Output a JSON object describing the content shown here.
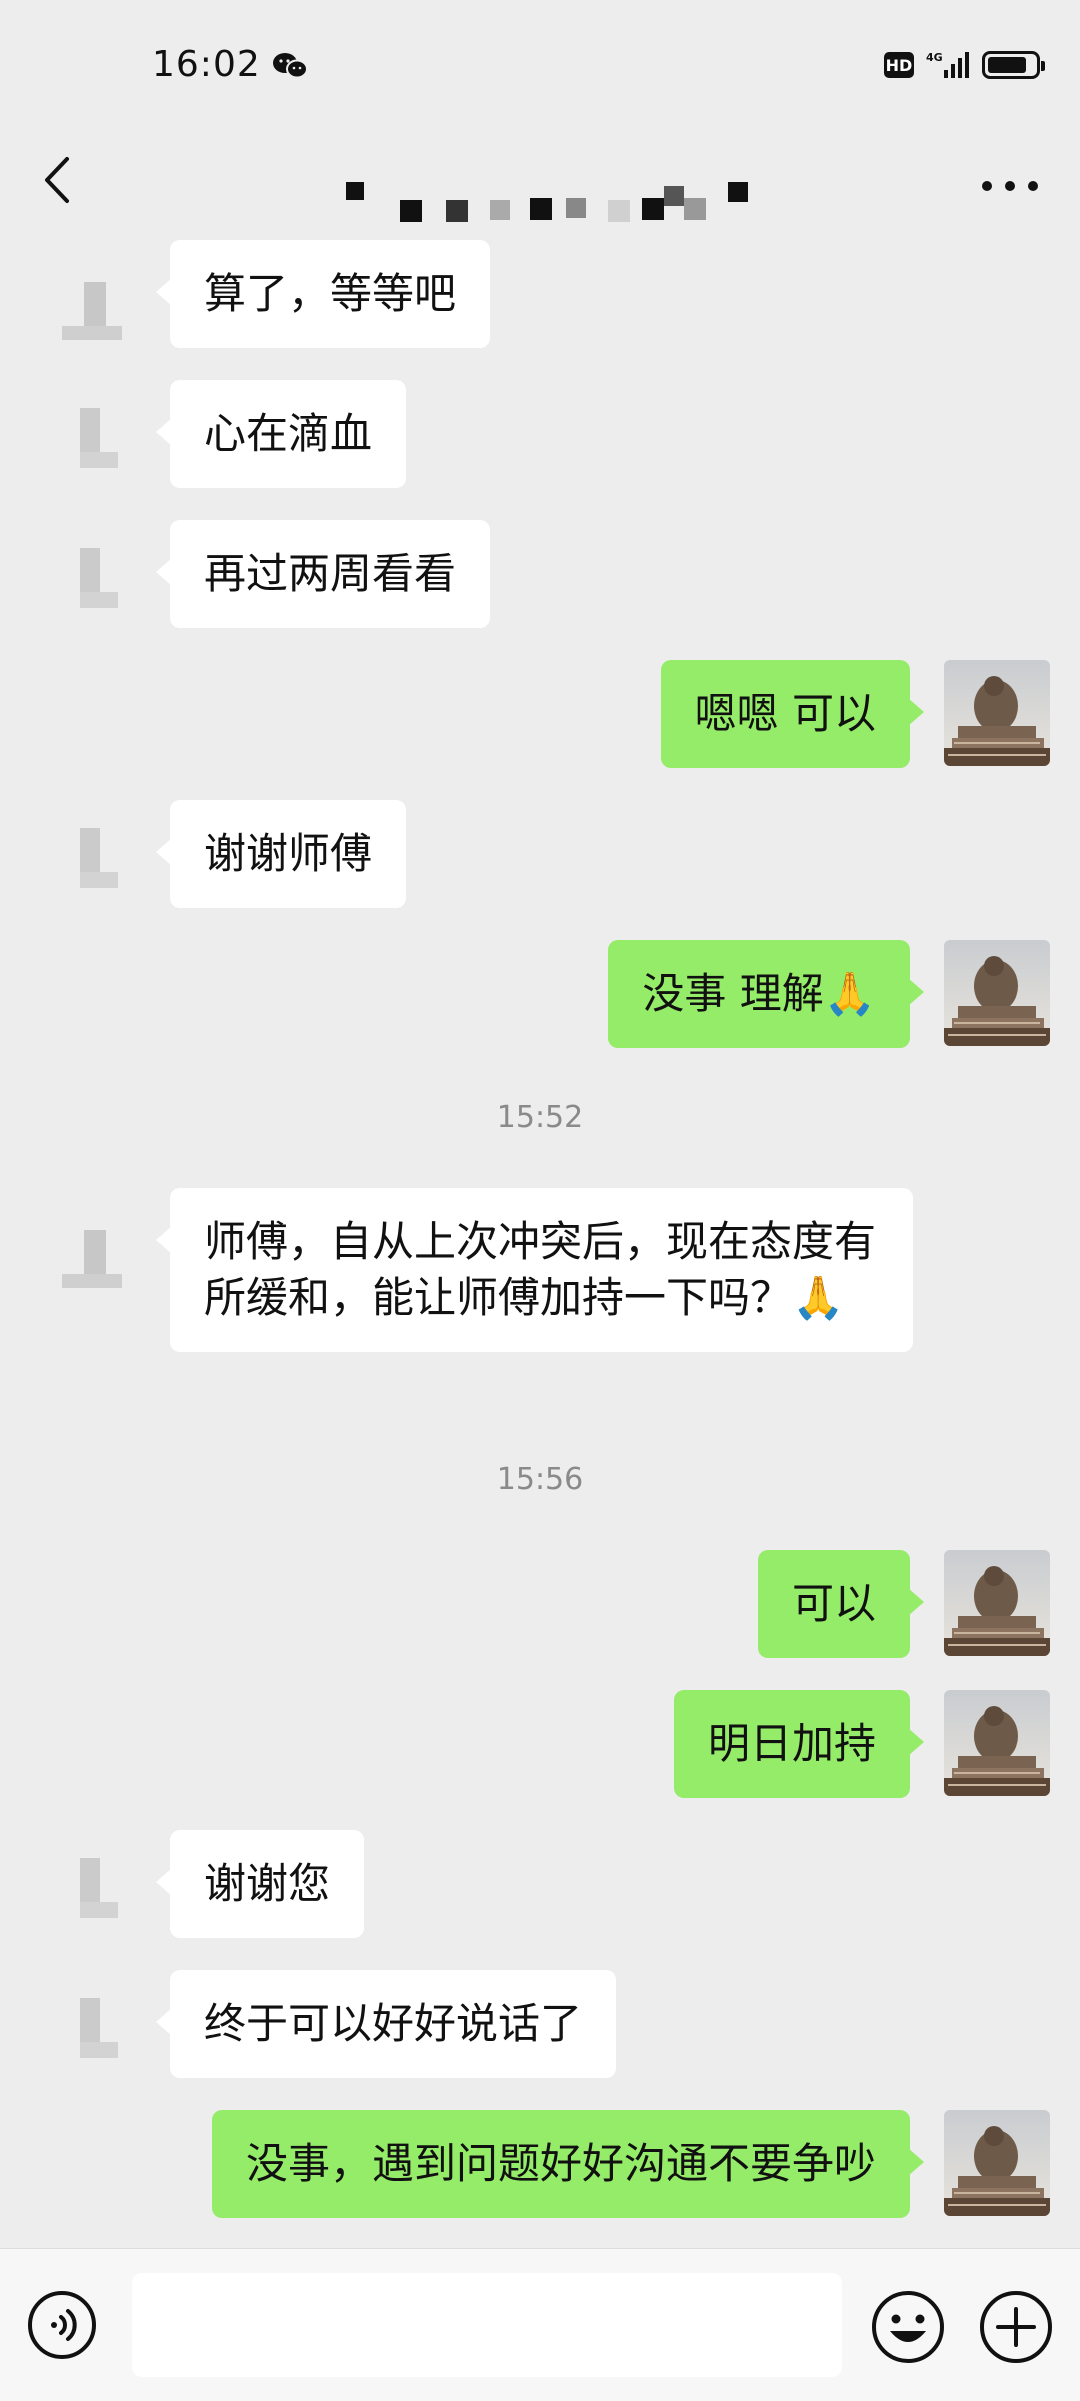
{
  "status_bar": {
    "time": "16:02",
    "hd_label": "HD",
    "network_label": "4G",
    "wechat_icon": "wechat-icon",
    "battery_icon": "battery-icon"
  },
  "header": {
    "back_icon": "chevron-left-icon",
    "more_icon": "more-dots-icon"
  },
  "messages": [
    {
      "side": "left",
      "text": "算了，等等吧"
    },
    {
      "side": "left",
      "text": "心在滴血"
    },
    {
      "side": "left",
      "text": "再过两周看看"
    },
    {
      "side": "right",
      "text": "嗯嗯 可以"
    },
    {
      "side": "left",
      "text": "谢谢师傅"
    },
    {
      "side": "right",
      "text": "没事 理解🙏"
    },
    {
      "side": "time",
      "text": "15:52"
    },
    {
      "side": "left",
      "text": "师傅，自从上次冲突后，现在态度有所缓和，能让师傅加持一下吗？🙏"
    },
    {
      "side": "time",
      "text": "15:56"
    },
    {
      "side": "right",
      "text": "可以"
    },
    {
      "side": "right",
      "text": "明日加持"
    },
    {
      "side": "left",
      "text": "谢谢您"
    },
    {
      "side": "left",
      "text": "终于可以好好说话了"
    },
    {
      "side": "right",
      "text": "没事，遇到问题好好沟通不要争吵"
    }
  ],
  "input_bar": {
    "voice_icon": "voice-icon",
    "emoji_icon": "emoji-icon",
    "plus_icon": "plus-icon",
    "input_value": ""
  },
  "colors": {
    "background": "#ededed",
    "self_bubble": "#95ec69",
    "other_bubble": "#ffffff",
    "timestamp": "#8a8a8a"
  }
}
